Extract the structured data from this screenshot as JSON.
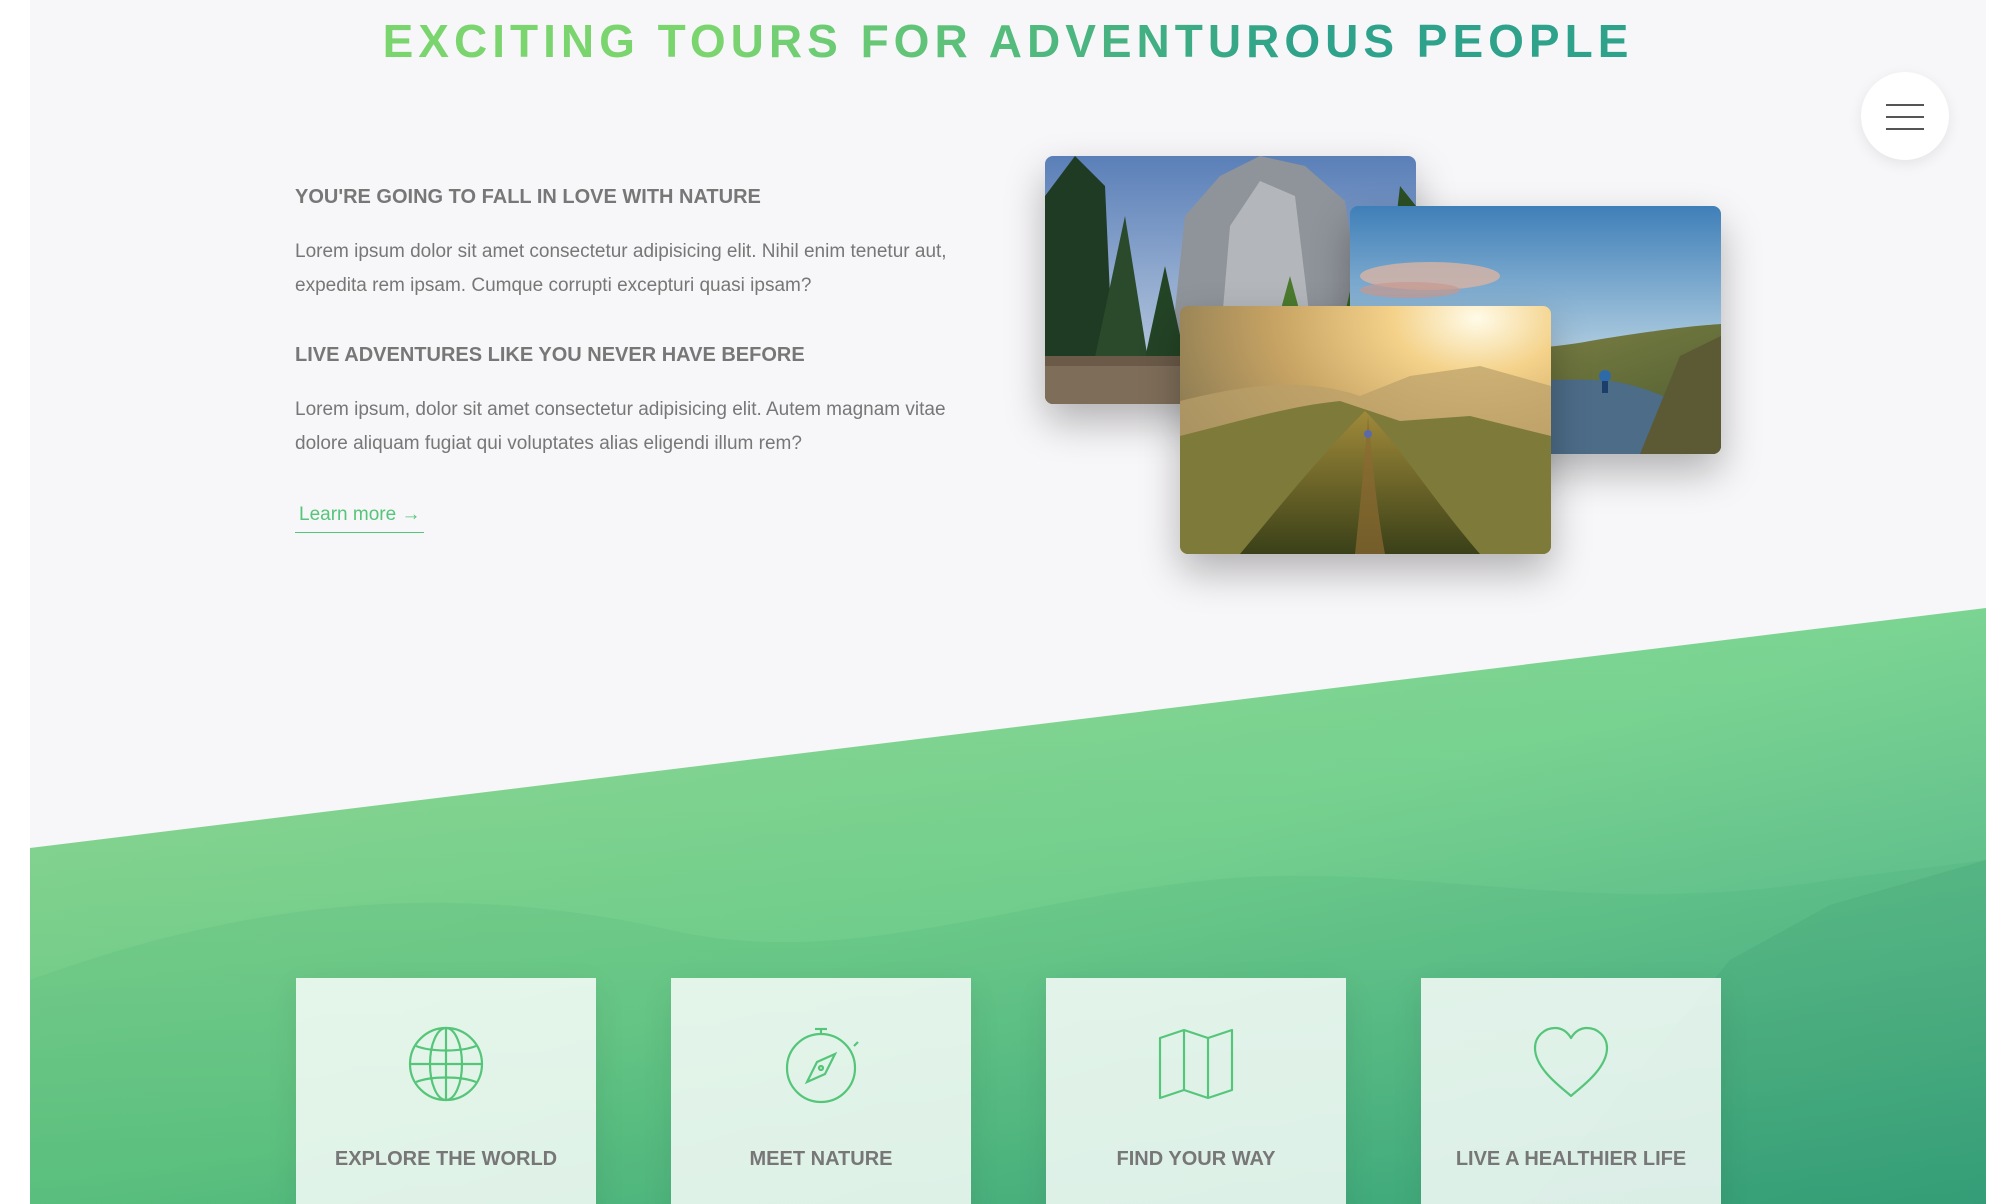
{
  "header": {
    "title": "EXCITING TOURS FOR ADVENTUROUS PEOPLE"
  },
  "navigation": {
    "menu_icon": "hamburger-menu-icon"
  },
  "about": {
    "sections": [
      {
        "heading": "YOU'RE GOING TO FALL IN LOVE WITH NATURE",
        "body": "Lorem ipsum dolor sit amet consectetur adipisicing elit. Nihil enim tenetur aut, expedita rem ipsam. Cumque corrupti excepturi quasi ipsam?"
      },
      {
        "heading": "LIVE ADVENTURES LIKE YOU NEVER HAVE BEFORE",
        "body": "Lorem ipsum, dolor sit amet consectetur adipisicing elit. Autem magnam vitae dolore aliquam fugiat qui voluptates alias eligendi illum rem?"
      }
    ],
    "learn_more": "Learn more →"
  },
  "features": [
    {
      "title": "EXPLORE THE WORLD",
      "icon": "globe-icon"
    },
    {
      "title": "MEET NATURE",
      "icon": "compass-icon"
    },
    {
      "title": "FIND YOUR WAY",
      "icon": "map-icon"
    },
    {
      "title": "LIVE A HEALTHIER LIFE",
      "icon": "heart-icon"
    }
  ],
  "colors": {
    "primary_light": "#7ed56f",
    "primary": "#55c57a",
    "primary_dark": "#28b485",
    "background": "#f7f7f7",
    "text_grey": "#777777"
  }
}
